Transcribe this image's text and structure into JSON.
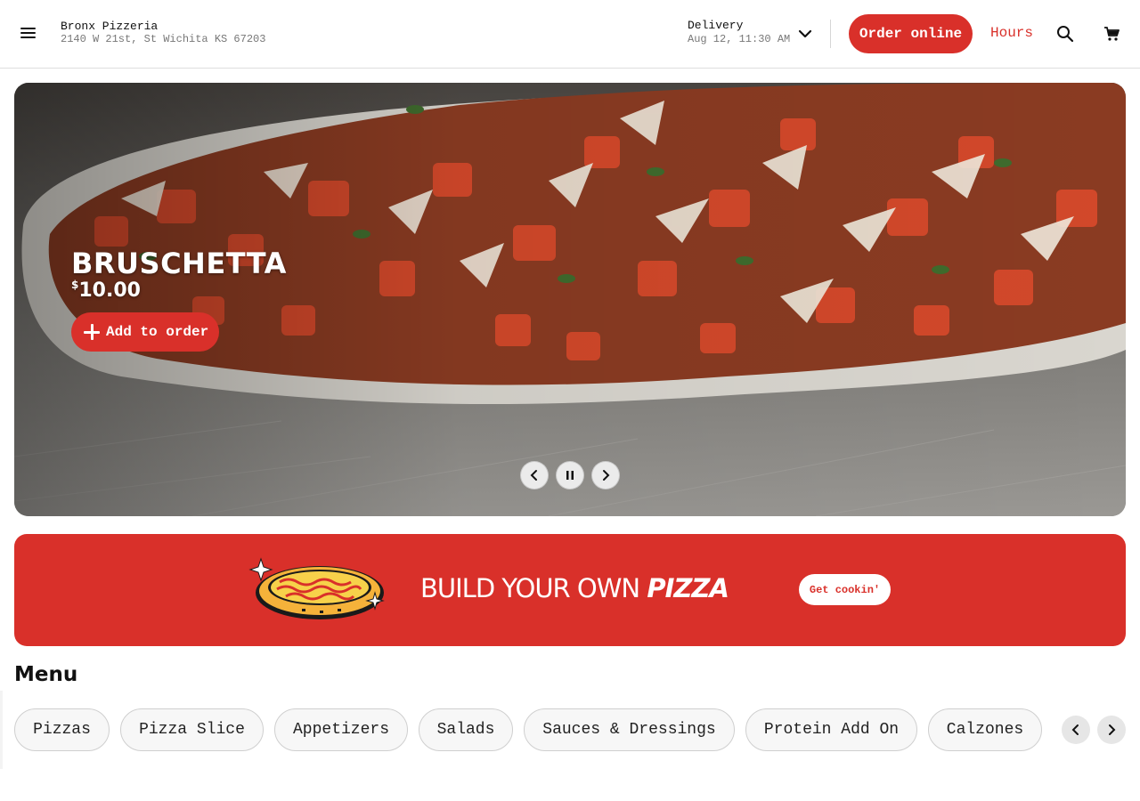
{
  "header": {
    "menu_icon": "hamburger-menu-icon",
    "store_name": "Bronx Pizzeria",
    "store_address": "2140 W 21st, St Wichita KS 67203",
    "delivery_label": "Delivery",
    "delivery_time": "Aug 12, 11:30 AM",
    "order_online_label": "Order online",
    "hours_label": "Hours",
    "search_icon": "search-icon",
    "cart_icon": "cart-icon"
  },
  "hero": {
    "title": "BRUSCHETTA",
    "price_symbol": "$",
    "price_value": "10.00",
    "add_label": "Add to order",
    "controls": [
      "previous-icon",
      "pause-icon",
      "next-icon"
    ]
  },
  "banner": {
    "text_regular": "BUILD YOUR OWN ",
    "text_bold": "PIZZA",
    "button_label": "Get cookin'"
  },
  "menu": {
    "heading": "Menu",
    "categories": [
      "Pizzas",
      "Pizza Slice",
      "Appetizers",
      "Salads",
      "Sauces & Dressings",
      "Protein Add On",
      "Calzones"
    ]
  },
  "colors": {
    "brand_red": "#d9302a",
    "chip_bg": "#f7f7f7",
    "text_dark": "#111111",
    "text_muted": "#777777"
  }
}
